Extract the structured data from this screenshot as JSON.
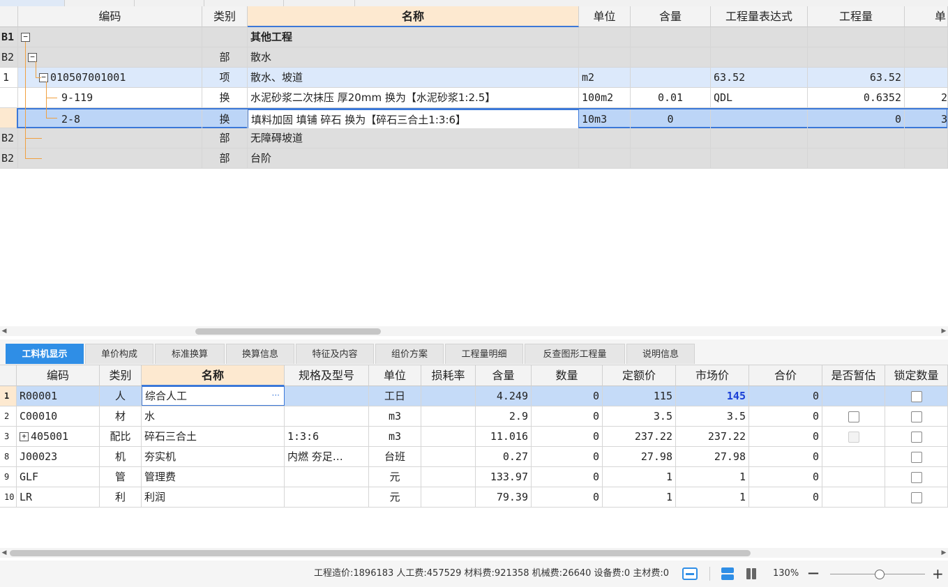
{
  "upper": {
    "headers": {
      "code": "编码",
      "type": "类别",
      "name": "名称",
      "unit": "单位",
      "qty_ratio": "含量",
      "expr": "工程量表达式",
      "qty": "工程量",
      "price": "单"
    },
    "rows": [
      {
        "num": "B1",
        "code": "",
        "type": "",
        "name": "其他工程",
        "unit": "",
        "ratio": "",
        "expr": "",
        "qty": "",
        "price": ""
      },
      {
        "num": "B2",
        "code": "",
        "type": "部",
        "name": "散水",
        "unit": "",
        "ratio": "",
        "expr": "",
        "qty": "",
        "price": ""
      },
      {
        "num": "1",
        "code": "010507001001",
        "type": "项",
        "name": "散水、坡道",
        "unit": "m2",
        "ratio": "",
        "expr": "63.52",
        "qty": "63.52",
        "price": ""
      },
      {
        "num": "",
        "code": "9-119",
        "type": "换",
        "name": "水泥砂浆二次抹压 厚20mm  换为【水泥砂浆1:2.5】",
        "unit": "100m2",
        "ratio": "0.01",
        "expr": "QDL",
        "qty": "0.6352",
        "price": "2"
      },
      {
        "num": "",
        "code": "2-8",
        "type": "换",
        "name": "填料加固 填铺 碎石  换为【碎石三合土1:3:6】",
        "unit": "10m3",
        "ratio": "0",
        "expr": "",
        "qty": "0",
        "price": "3"
      },
      {
        "num": "B2",
        "code": "",
        "type": "部",
        "name": "无障碍坡道",
        "unit": "",
        "ratio": "",
        "expr": "",
        "qty": "",
        "price": ""
      },
      {
        "num": "B2",
        "code": "",
        "type": "部",
        "name": "台阶",
        "unit": "",
        "ratio": "",
        "expr": "",
        "qty": "",
        "price": ""
      }
    ]
  },
  "tabs": [
    "工料机显示",
    "单价构成",
    "标准换算",
    "换算信息",
    "特征及内容",
    "组价方案",
    "工程量明细",
    "反查图形工程量",
    "说明信息"
  ],
  "lower": {
    "headers": {
      "code": "编码",
      "type": "类别",
      "name": "名称",
      "spec": "规格及型号",
      "unit": "单位",
      "loss": "损耗率",
      "ratio": "含量",
      "count": "数量",
      "base": "定额价",
      "market": "市场价",
      "total": "合价",
      "temp": "是否暂估",
      "lock": "锁定数量"
    },
    "rows": [
      {
        "num": "1",
        "code": "R00001",
        "type": "人",
        "name": "综合人工",
        "spec": "",
        "unit": "工日",
        "loss": "",
        "ratio": "4.249",
        "count": "0",
        "base": "115",
        "market": "145",
        "total": "0"
      },
      {
        "num": "2",
        "code": "C00010",
        "type": "材",
        "name": "水",
        "spec": "",
        "unit": "m3",
        "loss": "",
        "ratio": "2.9",
        "count": "0",
        "base": "3.5",
        "market": "3.5",
        "total": "0"
      },
      {
        "num": "3",
        "code": "405001",
        "type": "配比",
        "name": "碎石三合土",
        "spec": "1:3:6",
        "unit": "m3",
        "loss": "",
        "ratio": "11.016",
        "count": "0",
        "base": "237.22",
        "market": "237.22",
        "total": "0"
      },
      {
        "num": "8",
        "code": "J00023",
        "type": "机",
        "name": "夯实机",
        "spec": "内燃 夯足…",
        "unit": "台班",
        "loss": "",
        "ratio": "0.27",
        "count": "0",
        "base": "27.98",
        "market": "27.98",
        "total": "0"
      },
      {
        "num": "9",
        "code": "GLF",
        "type": "管",
        "name": "管理费",
        "spec": "",
        "unit": "元",
        "loss": "",
        "ratio": "133.97",
        "count": "0",
        "base": "1",
        "market": "1",
        "total": "0"
      },
      {
        "num": "10",
        "code": "LR",
        "type": "利",
        "name": "利润",
        "spec": "",
        "unit": "元",
        "loss": "",
        "ratio": "79.39",
        "count": "0",
        "base": "1",
        "market": "1",
        "total": "0"
      }
    ],
    "ellipsis": "···"
  },
  "status": {
    "summary": "工程造价:1896183  人工费:457529  材料费:921358  机械费:26640  设备费:0  主材费:0",
    "zoom": "130%",
    "minus": "—",
    "plus": "+"
  },
  "colors": {
    "accent": "#2f8ee6",
    "selected_row": "#c5dbf8",
    "header_name": "#fde9d0",
    "market_price_text": "#1a3fd6"
  }
}
